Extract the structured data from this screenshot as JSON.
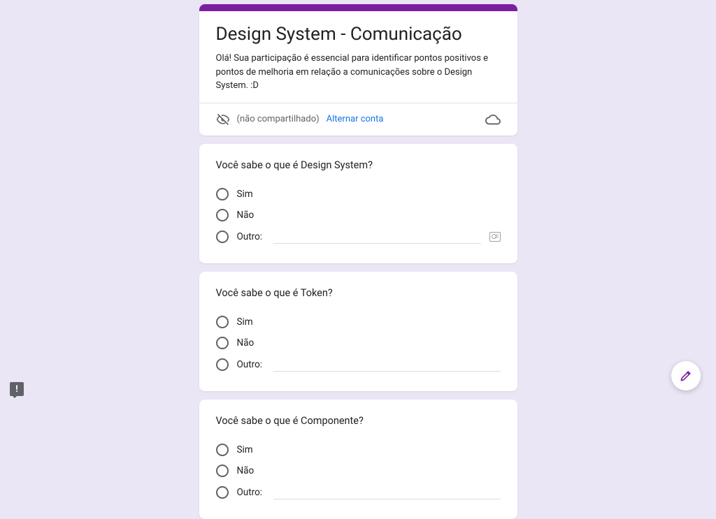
{
  "header": {
    "title": "Design System - Comunicação",
    "description": "Olá! Sua participação é essencial para identificar pontos positivos e pontos de melhoria em relação a comunicações sobre o Design System. :D",
    "not_shared_label": "(não compartilhado)",
    "switch_account_label": "Alternar conta"
  },
  "questions": [
    {
      "title": "Você sabe o que é Design System?",
      "options": [
        "Sim",
        "Não"
      ],
      "other_label": "Outro:",
      "has_tip_icon": true
    },
    {
      "title": "Você sabe o que é Token?",
      "options": [
        "Sim",
        "Não"
      ],
      "other_label": "Outro:",
      "has_tip_icon": false
    },
    {
      "title": "Você sabe o que é Componente?",
      "options": [
        "Sim",
        "Não"
      ],
      "other_label": "Outro:",
      "has_tip_icon": false
    }
  ]
}
